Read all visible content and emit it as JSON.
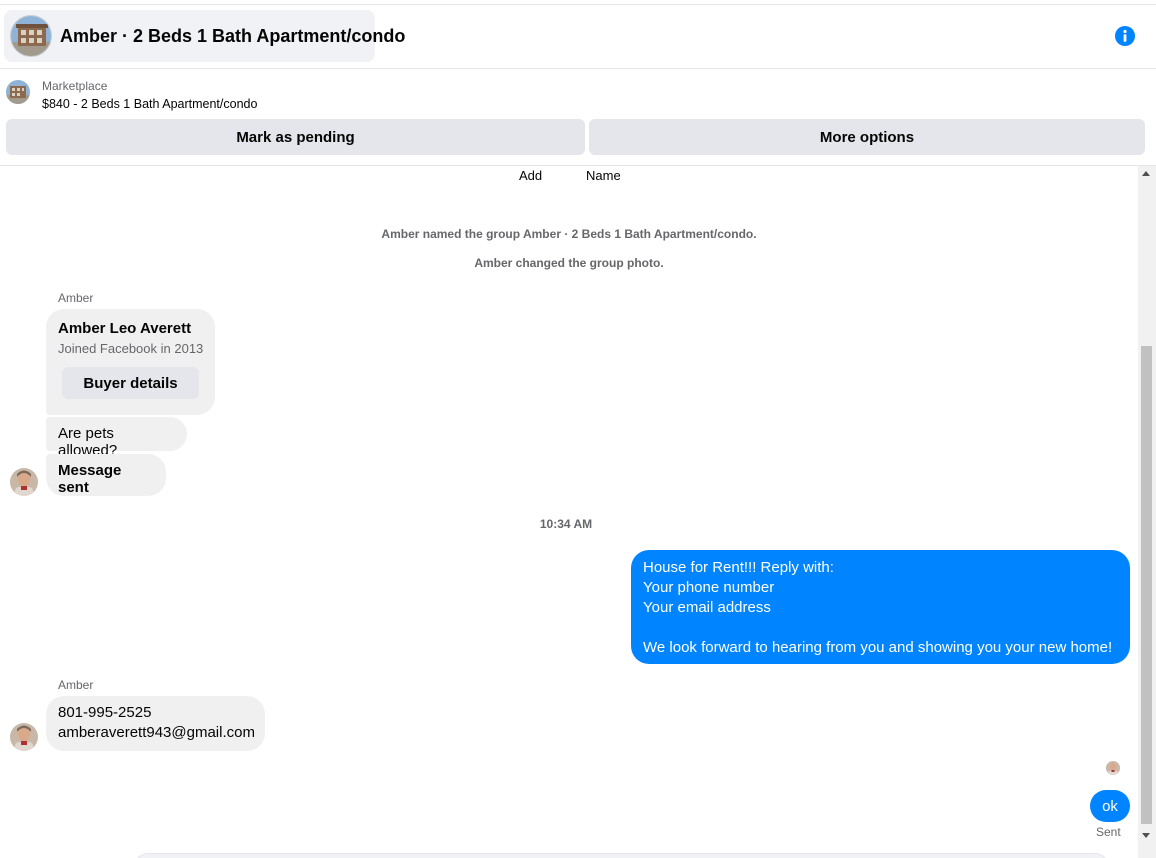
{
  "header": {
    "title": "Amber · 2 Beds 1 Bath Apartment/condo",
    "info_icon": "info-circle-icon",
    "accent": "#0084ff"
  },
  "listing": {
    "category": "Marketplace",
    "title": "$840 - 2 Beds 1 Bath Apartment/condo",
    "buttons": {
      "pending": "Mark as pending",
      "more": "More options"
    }
  },
  "chat": {
    "top_links": [
      "Add",
      "Name"
    ],
    "system_messages": [
      "Amber named the group Amber · 2 Beds 1 Bath Apartment/condo.",
      "Amber changed the group photo."
    ],
    "sender_name": "Amber",
    "buyer_card": {
      "name": "Amber Leo Averett",
      "joined": "Joined Facebook in 2013",
      "button": "Buyer details"
    },
    "incoming": [
      "Are pets allowed?",
      "Message sent"
    ],
    "timestamp": "10:34 AM",
    "outgoing_long": "House for Rent!!! Reply with:\nYour phone number\nYour email address\n\nWe look forward to hearing from you and showing you your new home!",
    "reply": "801-995-2525\namberaverett943@gmail.com",
    "outgoing_short": "ok",
    "delivery_status": "Sent"
  }
}
